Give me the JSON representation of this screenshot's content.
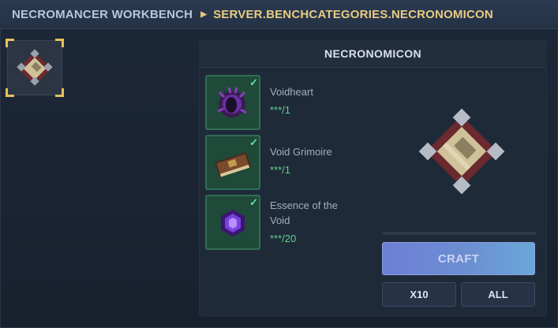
{
  "breadcrumb": {
    "root": "NECROMANCER WORKBENCH",
    "category": "SERVER.BENCHCATEGORIES.NECRONOMICON"
  },
  "category_slots": [
    {
      "icon": "necronomicon-icon",
      "selected": true
    }
  ],
  "recipe": {
    "title": "NECRONOMICON",
    "result_icon": "necronomicon-icon",
    "ingredients": [
      {
        "name": "Voidheart",
        "count": "***/1",
        "icon": "voidheart-icon",
        "satisfied": true
      },
      {
        "name": "Void Grimoire",
        "count": "***/1",
        "icon": "void-grimoire-icon",
        "satisfied": true
      },
      {
        "name": "Essence of the Void",
        "count": "***/20",
        "icon": "void-essence-icon",
        "satisfied": true
      }
    ]
  },
  "actions": {
    "craft": "CRAFT",
    "x10": "X10",
    "all": "ALL"
  },
  "colors": {
    "accent_gold": "#e9cc82",
    "satisfied_green": "#5fd38b",
    "craft_button": "#6e7fd6"
  }
}
